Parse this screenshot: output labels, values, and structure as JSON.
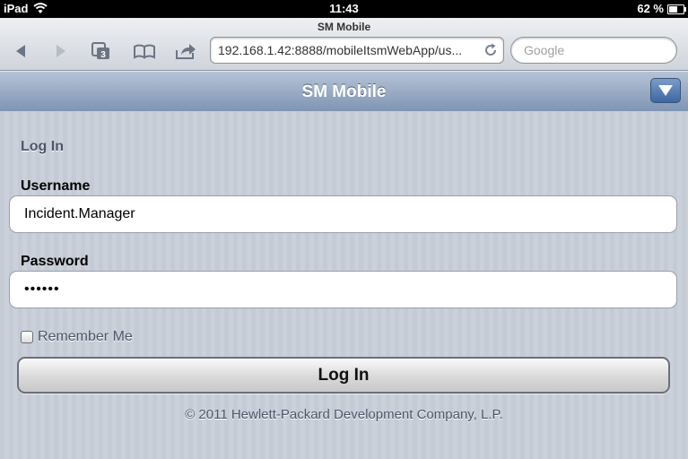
{
  "status_bar": {
    "device": "iPad",
    "time": "11:43",
    "battery_percent": "62 %",
    "battery_level": 0.62
  },
  "browser": {
    "page_title": "SM Mobile",
    "tab_count": "3",
    "url": "192.168.1.42:8888/mobileItsmWebApp/us...",
    "search_placeholder": "Google",
    "icons": [
      "back-arrow-icon",
      "forward-arrow-icon",
      "tabs-icon",
      "bookmarks-icon",
      "share-icon",
      "reload-icon"
    ]
  },
  "app": {
    "title": "SM Mobile",
    "menu_icon": "triangle-down-icon",
    "accent": "#3d67a3"
  },
  "login": {
    "section_title": "Log In",
    "username_label": "Username",
    "username_value": "Incident.Manager",
    "password_label": "Password",
    "password_value": "••••••",
    "remember_label": "Remember Me",
    "remember_checked": false,
    "button_label": "Log In"
  },
  "footer": {
    "copyright": "© 2011 Hewlett-Packard Development Company, L.P."
  }
}
